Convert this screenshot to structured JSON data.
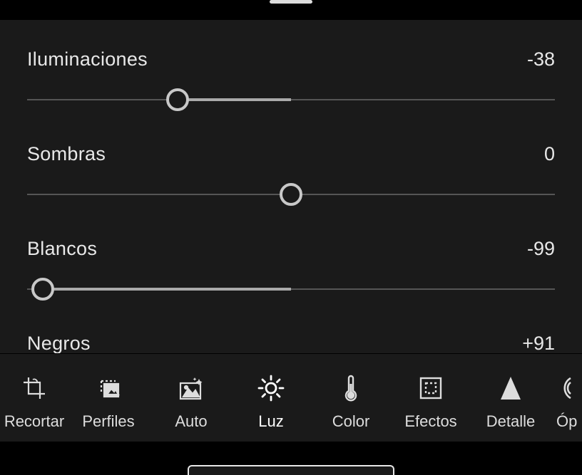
{
  "sliders": {
    "highlights": {
      "label": "Iluminaciones",
      "value": -38,
      "min": -100,
      "max": 100
    },
    "shadows": {
      "label": "Sombras",
      "value": 0,
      "min": -100,
      "max": 100
    },
    "whites": {
      "label": "Blancos",
      "value": -99,
      "min": -100,
      "max": 100
    },
    "blacks": {
      "label": "Negros",
      "value": 91,
      "min": -100,
      "max": 100
    }
  },
  "slider_display": {
    "highlights": "-38",
    "shadows": "0",
    "whites": "-99",
    "blacks": "+91"
  },
  "toolbar": {
    "crop": {
      "label": "Recortar"
    },
    "profiles": {
      "label": "Perfiles"
    },
    "auto": {
      "label": "Auto"
    },
    "light": {
      "label": "Luz"
    },
    "color": {
      "label": "Color"
    },
    "effects": {
      "label": "Efectos"
    },
    "detail": {
      "label": "Detalle"
    },
    "optics": {
      "label": "Óp"
    }
  },
  "active_tool": "light"
}
